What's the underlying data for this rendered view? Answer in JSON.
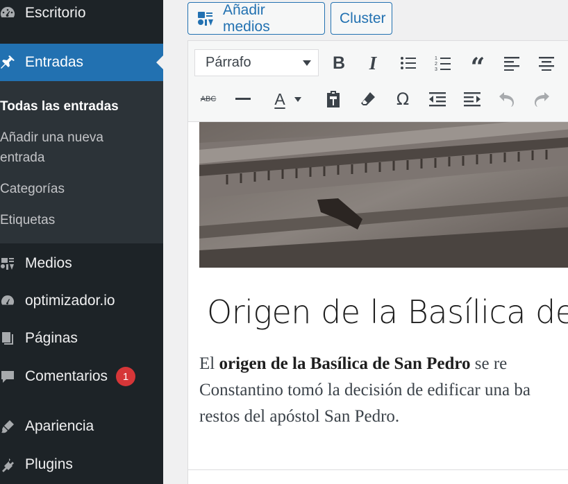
{
  "sidebar": {
    "items": [
      {
        "label": "Escritorio",
        "icon": "dashboard-icon"
      },
      {
        "label": "Entradas",
        "icon": "pin-icon"
      },
      {
        "label": "Medios",
        "icon": "media-icon"
      },
      {
        "label": "optimizador.io",
        "icon": "gauge-icon"
      },
      {
        "label": "Páginas",
        "icon": "page-icon"
      },
      {
        "label": "Comentarios",
        "icon": "comment-icon",
        "badge": "1"
      },
      {
        "label": "Apariencia",
        "icon": "brush-icon"
      },
      {
        "label": "Plugins",
        "icon": "plug-icon"
      }
    ],
    "submenu": [
      "Todas las entradas",
      "Añadir una nueva",
      "entrada",
      "Categorías",
      "Etiquetas"
    ]
  },
  "media_buttons": {
    "add_media": "Añadir medios",
    "cluster": "Cluster"
  },
  "toolbar": {
    "format_value": "Párrafo",
    "strikethrough_label": "ABC",
    "text_color_label": "A"
  },
  "post": {
    "heading": "Origen de la Basílica de Sa",
    "body_prefix": "El ",
    "body_bold": "origen de la Basílica de San Pedro",
    "body_rest_1": " se re",
    "body_line_2": "Constantino tomó la decisión de edificar una ba",
    "body_line_3": "restos del apóstol San Pedro."
  },
  "colors": {
    "sidebar_bg": "#1d2327",
    "accent": "#2271b1",
    "badge": "#d63638"
  }
}
